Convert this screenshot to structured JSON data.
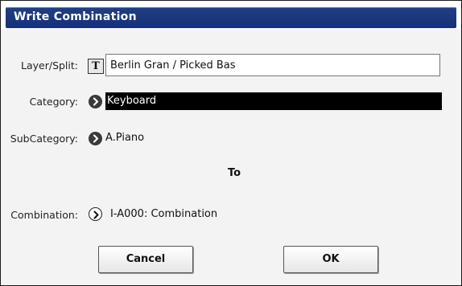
{
  "dialog": {
    "title": "Write Combination"
  },
  "layer_split": {
    "label": "Layer/Split:",
    "text_button": "T",
    "value": "Berlin Gran / Picked Bas"
  },
  "category": {
    "label": "Category:",
    "value": "Keyboard"
  },
  "subcategory": {
    "label": "SubCategory:",
    "value": "A.Piano"
  },
  "to_label": "To",
  "combination": {
    "label": "Combination:",
    "value": "I-A000: Combination"
  },
  "buttons": {
    "cancel": "Cancel",
    "ok": "OK"
  },
  "colors": {
    "title_bar": "#1b3680",
    "selection": "#000000",
    "background": "#f3f3f3"
  },
  "icons": {
    "popup": "chevron-right-circle-icon"
  }
}
